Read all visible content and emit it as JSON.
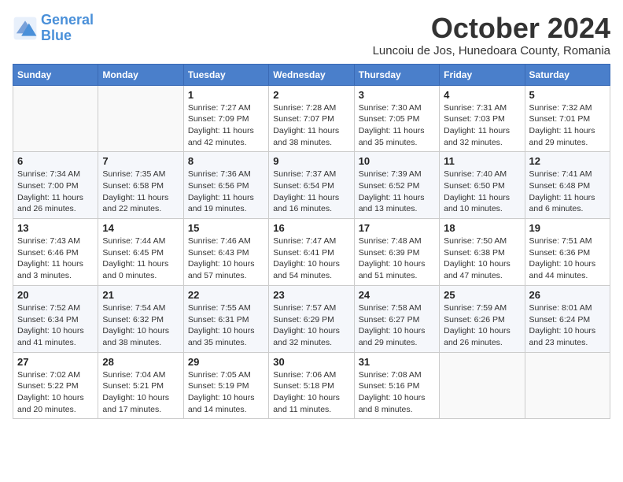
{
  "header": {
    "logo_line1": "General",
    "logo_line2": "Blue",
    "month": "October 2024",
    "location": "Luncoiu de Jos, Hunedoara County, Romania"
  },
  "weekdays": [
    "Sunday",
    "Monday",
    "Tuesday",
    "Wednesday",
    "Thursday",
    "Friday",
    "Saturday"
  ],
  "weeks": [
    [
      {
        "day": "",
        "text": ""
      },
      {
        "day": "",
        "text": ""
      },
      {
        "day": "1",
        "text": "Sunrise: 7:27 AM\nSunset: 7:09 PM\nDaylight: 11 hours and 42 minutes."
      },
      {
        "day": "2",
        "text": "Sunrise: 7:28 AM\nSunset: 7:07 PM\nDaylight: 11 hours and 38 minutes."
      },
      {
        "day": "3",
        "text": "Sunrise: 7:30 AM\nSunset: 7:05 PM\nDaylight: 11 hours and 35 minutes."
      },
      {
        "day": "4",
        "text": "Sunrise: 7:31 AM\nSunset: 7:03 PM\nDaylight: 11 hours and 32 minutes."
      },
      {
        "day": "5",
        "text": "Sunrise: 7:32 AM\nSunset: 7:01 PM\nDaylight: 11 hours and 29 minutes."
      }
    ],
    [
      {
        "day": "6",
        "text": "Sunrise: 7:34 AM\nSunset: 7:00 PM\nDaylight: 11 hours and 26 minutes."
      },
      {
        "day": "7",
        "text": "Sunrise: 7:35 AM\nSunset: 6:58 PM\nDaylight: 11 hours and 22 minutes."
      },
      {
        "day": "8",
        "text": "Sunrise: 7:36 AM\nSunset: 6:56 PM\nDaylight: 11 hours and 19 minutes."
      },
      {
        "day": "9",
        "text": "Sunrise: 7:37 AM\nSunset: 6:54 PM\nDaylight: 11 hours and 16 minutes."
      },
      {
        "day": "10",
        "text": "Sunrise: 7:39 AM\nSunset: 6:52 PM\nDaylight: 11 hours and 13 minutes."
      },
      {
        "day": "11",
        "text": "Sunrise: 7:40 AM\nSunset: 6:50 PM\nDaylight: 11 hours and 10 minutes."
      },
      {
        "day": "12",
        "text": "Sunrise: 7:41 AM\nSunset: 6:48 PM\nDaylight: 11 hours and 6 minutes."
      }
    ],
    [
      {
        "day": "13",
        "text": "Sunrise: 7:43 AM\nSunset: 6:46 PM\nDaylight: 11 hours and 3 minutes."
      },
      {
        "day": "14",
        "text": "Sunrise: 7:44 AM\nSunset: 6:45 PM\nDaylight: 11 hours and 0 minutes."
      },
      {
        "day": "15",
        "text": "Sunrise: 7:46 AM\nSunset: 6:43 PM\nDaylight: 10 hours and 57 minutes."
      },
      {
        "day": "16",
        "text": "Sunrise: 7:47 AM\nSunset: 6:41 PM\nDaylight: 10 hours and 54 minutes."
      },
      {
        "day": "17",
        "text": "Sunrise: 7:48 AM\nSunset: 6:39 PM\nDaylight: 10 hours and 51 minutes."
      },
      {
        "day": "18",
        "text": "Sunrise: 7:50 AM\nSunset: 6:38 PM\nDaylight: 10 hours and 47 minutes."
      },
      {
        "day": "19",
        "text": "Sunrise: 7:51 AM\nSunset: 6:36 PM\nDaylight: 10 hours and 44 minutes."
      }
    ],
    [
      {
        "day": "20",
        "text": "Sunrise: 7:52 AM\nSunset: 6:34 PM\nDaylight: 10 hours and 41 minutes."
      },
      {
        "day": "21",
        "text": "Sunrise: 7:54 AM\nSunset: 6:32 PM\nDaylight: 10 hours and 38 minutes."
      },
      {
        "day": "22",
        "text": "Sunrise: 7:55 AM\nSunset: 6:31 PM\nDaylight: 10 hours and 35 minutes."
      },
      {
        "day": "23",
        "text": "Sunrise: 7:57 AM\nSunset: 6:29 PM\nDaylight: 10 hours and 32 minutes."
      },
      {
        "day": "24",
        "text": "Sunrise: 7:58 AM\nSunset: 6:27 PM\nDaylight: 10 hours and 29 minutes."
      },
      {
        "day": "25",
        "text": "Sunrise: 7:59 AM\nSunset: 6:26 PM\nDaylight: 10 hours and 26 minutes."
      },
      {
        "day": "26",
        "text": "Sunrise: 8:01 AM\nSunset: 6:24 PM\nDaylight: 10 hours and 23 minutes."
      }
    ],
    [
      {
        "day": "27",
        "text": "Sunrise: 7:02 AM\nSunset: 5:22 PM\nDaylight: 10 hours and 20 minutes."
      },
      {
        "day": "28",
        "text": "Sunrise: 7:04 AM\nSunset: 5:21 PM\nDaylight: 10 hours and 17 minutes."
      },
      {
        "day": "29",
        "text": "Sunrise: 7:05 AM\nSunset: 5:19 PM\nDaylight: 10 hours and 14 minutes."
      },
      {
        "day": "30",
        "text": "Sunrise: 7:06 AM\nSunset: 5:18 PM\nDaylight: 10 hours and 11 minutes."
      },
      {
        "day": "31",
        "text": "Sunrise: 7:08 AM\nSunset: 5:16 PM\nDaylight: 10 hours and 8 minutes."
      },
      {
        "day": "",
        "text": ""
      },
      {
        "day": "",
        "text": ""
      }
    ]
  ]
}
